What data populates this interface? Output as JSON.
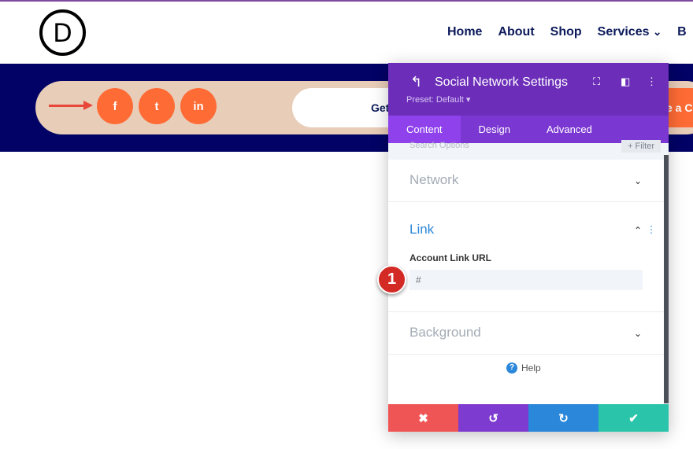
{
  "header": {
    "logo": "D",
    "nav": [
      "Home",
      "About",
      "Shop",
      "Services",
      "B"
    ],
    "services_chevron": "⌄"
  },
  "hero": {
    "social_icons": [
      "f",
      "t",
      "in"
    ],
    "get_button": "Get",
    "orange_button": "e a Co"
  },
  "modal": {
    "title": "Social Network Settings",
    "preset": "Preset: Default ▾",
    "tabs": [
      "Content",
      "Design",
      "Advanced"
    ],
    "active_tab": "Content",
    "search_placeholder": "Search Options",
    "filter_label": "+ Filter",
    "sections": {
      "network": "Network",
      "link": "Link",
      "background": "Background"
    },
    "field_label": "Account Link URL",
    "field_placeholder": "#",
    "help": "Help",
    "footer": {
      "cancel": "✖",
      "undo": "↺",
      "redo": "↻",
      "save": "✔"
    },
    "colors": {
      "header": "#6c2eb9",
      "cancel": "#ef5555",
      "undo": "#7e3bd0",
      "redo": "#2b87da",
      "save": "#29c4a9"
    }
  },
  "annotation": {
    "step": "1"
  }
}
